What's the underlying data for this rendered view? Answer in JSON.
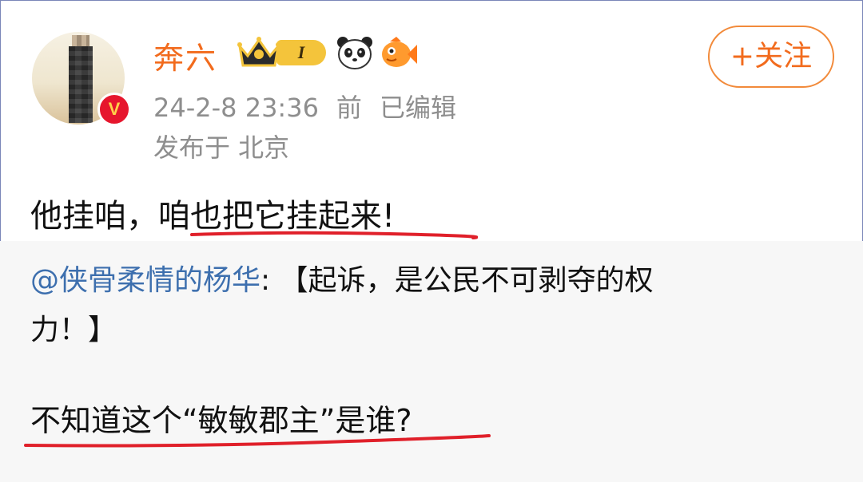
{
  "post": {
    "username": "奔六",
    "level_badge": "I",
    "timestamp": "24-2-8 23:36",
    "time_suffix": "前",
    "edited": "已编辑",
    "location": "发布于 北京",
    "follow_label": "+关注",
    "text": "他挂咱，咱也把它挂起来!"
  },
  "repost": {
    "mention": "@侠骨柔情的杨华",
    "separator": ": ",
    "line1_rest": "【起诉，是公民不可剥夺的权",
    "line2": "力！】",
    "question": "不知道这个“敏敏郡主”是谁?"
  },
  "colors": {
    "username": "#f26b1d",
    "mention": "#3d6fae",
    "meta": "#8e8e8e",
    "underline": "#e0202a",
    "verified": "#e6162d"
  },
  "icons": [
    "crown-icon",
    "panda-icon",
    "fish-icon",
    "verified-icon"
  ]
}
